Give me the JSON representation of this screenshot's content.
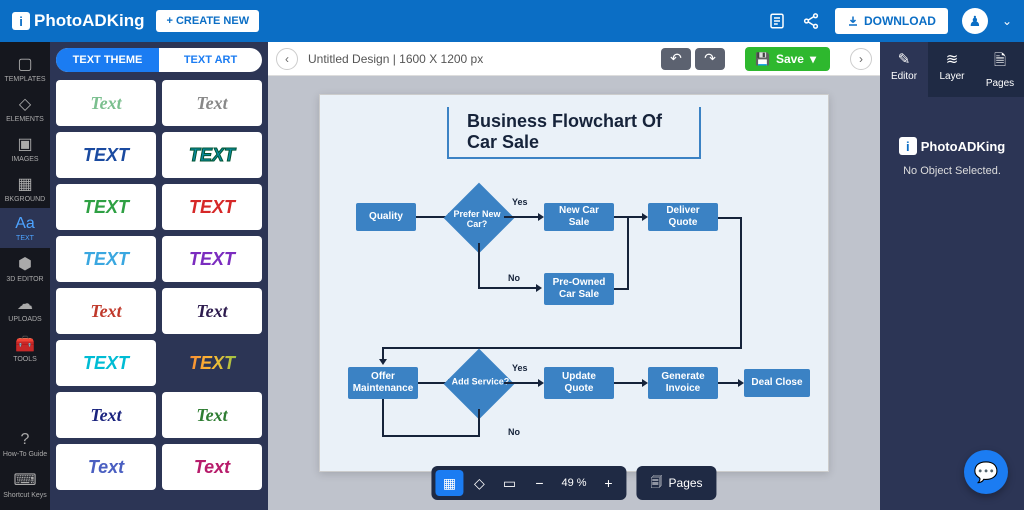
{
  "brand": "PhotoADKing",
  "header": {
    "create": "+ CREATE NEW",
    "download": "DOWNLOAD"
  },
  "rail": {
    "items": [
      "TEMPLATES",
      "ELEMENTS",
      "IMAGES",
      "BKGROUND",
      "TEXT",
      "3D EDITOR",
      "UPLOADS",
      "TOOLS"
    ],
    "bottom": [
      "How-To Guide",
      "Shortcut Keys"
    ]
  },
  "panel": {
    "tabs": [
      "TEXT THEME",
      "TEXT ART"
    ]
  },
  "toolbar": {
    "doc": "Untitled Design | 1600 X 1200 px",
    "save": "Save"
  },
  "chart_data": {
    "type": "flowchart",
    "title": "Business Flowchart Of Car Sale",
    "nodes": [
      {
        "id": "quality",
        "type": "process",
        "label": "Quality"
      },
      {
        "id": "prefer",
        "type": "decision",
        "label": "Prefer New Car?"
      },
      {
        "id": "newcar",
        "type": "process",
        "label": "New Car Sale"
      },
      {
        "id": "deliver",
        "type": "process",
        "label": "Deliver Quote"
      },
      {
        "id": "preowned",
        "type": "process",
        "label": "Pre-Owned Car Sale"
      },
      {
        "id": "offer",
        "type": "process",
        "label": "Offer Maintenance"
      },
      {
        "id": "service",
        "type": "decision",
        "label": "Add Service?"
      },
      {
        "id": "update",
        "type": "process",
        "label": "Update Quote"
      },
      {
        "id": "invoice",
        "type": "process",
        "label": "Generate Invoice"
      },
      {
        "id": "close",
        "type": "process",
        "label": "Deal Close"
      }
    ],
    "edges": [
      {
        "from": "quality",
        "to": "prefer"
      },
      {
        "from": "prefer",
        "to": "newcar",
        "label": "Yes"
      },
      {
        "from": "prefer",
        "to": "preowned",
        "label": "No"
      },
      {
        "from": "newcar",
        "to": "deliver"
      },
      {
        "from": "preowned",
        "to": "deliver"
      },
      {
        "from": "deliver",
        "to": "offer"
      },
      {
        "from": "offer",
        "to": "service"
      },
      {
        "from": "service",
        "to": "update",
        "label": "Yes"
      },
      {
        "from": "service",
        "to": "offer",
        "label": "No"
      },
      {
        "from": "update",
        "to": "invoice"
      },
      {
        "from": "invoice",
        "to": "close"
      }
    ]
  },
  "bottombar": {
    "zoom": "49 %",
    "pages": "Pages"
  },
  "right": {
    "tabs": [
      "Editor",
      "Layer",
      "Pages"
    ],
    "no_selection": "No Object Selected."
  }
}
